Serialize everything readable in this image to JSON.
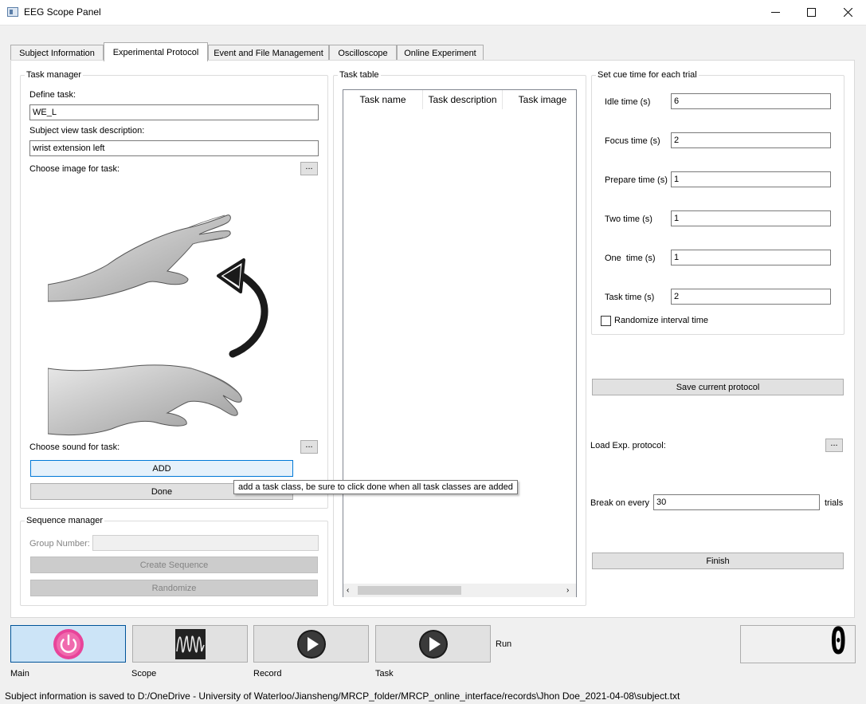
{
  "window": {
    "title": "EEG Scope Panel"
  },
  "tabs": [
    {
      "label": "Subject Information"
    },
    {
      "label": "Experimental Protocol"
    },
    {
      "label": "Event and File Management"
    },
    {
      "label": "Oscilloscope"
    },
    {
      "label": "Online Experiment"
    }
  ],
  "task_manager": {
    "title": "Task manager",
    "define_task_label": "Define task:",
    "define_task_value": "WE_L",
    "description_label": "Subject view task description:",
    "description_value": "wrist extension left",
    "image_label": "Choose image for task:",
    "sound_label": "Choose sound for task:",
    "browse_label": "...",
    "add_label": "ADD",
    "done_label": "Done",
    "tooltip": "add a task class, be sure to click done when all task classes are added"
  },
  "sequence_manager": {
    "title": "Sequence manager",
    "group_number_label": "Group Number:",
    "group_number_value": "",
    "create_label": "Create Sequence",
    "randomize_label": "Randomize"
  },
  "task_table": {
    "title": "Task table",
    "columns": [
      "Task name",
      "Task description",
      "Task image"
    ]
  },
  "cue_time": {
    "title": "Set cue time for each trial",
    "fields": [
      {
        "label": "Idle time (s)",
        "value": "6"
      },
      {
        "label": "Focus time (s)",
        "value": "2"
      },
      {
        "label": "Prepare time (s)",
        "value": "1"
      },
      {
        "label": "Two time (s)",
        "value": "1"
      },
      {
        "label": "One  time (s)",
        "value": "1"
      },
      {
        "label": "Task time (s)",
        "value": "2"
      }
    ],
    "randomize_label": "Randomize interval time",
    "randomize_checked": false
  },
  "protocol": {
    "save_label": "Save current protocol",
    "load_label": "Load Exp. protocol:",
    "browse_label": "...",
    "break_label": "Break on every",
    "break_value": "30",
    "trials_label": "trials",
    "finish_label": "Finish"
  },
  "toolbar": {
    "main_label": "Main",
    "scope_label": "Scope",
    "record_label": "Record",
    "task_label": "Task",
    "run_label": "Run",
    "counter": "0"
  },
  "status": {
    "text": "Subject information is saved to D:/OneDrive - University of Waterloo/Jiansheng/MRCP_folder/MRCP_online_interface/records\\Jhon Doe_2021-04-08\\subject.txt"
  },
  "colors": {
    "power_icon": "#e8449a",
    "play_icon": "#1a1a1a",
    "active_tool": "#cce4f7"
  }
}
